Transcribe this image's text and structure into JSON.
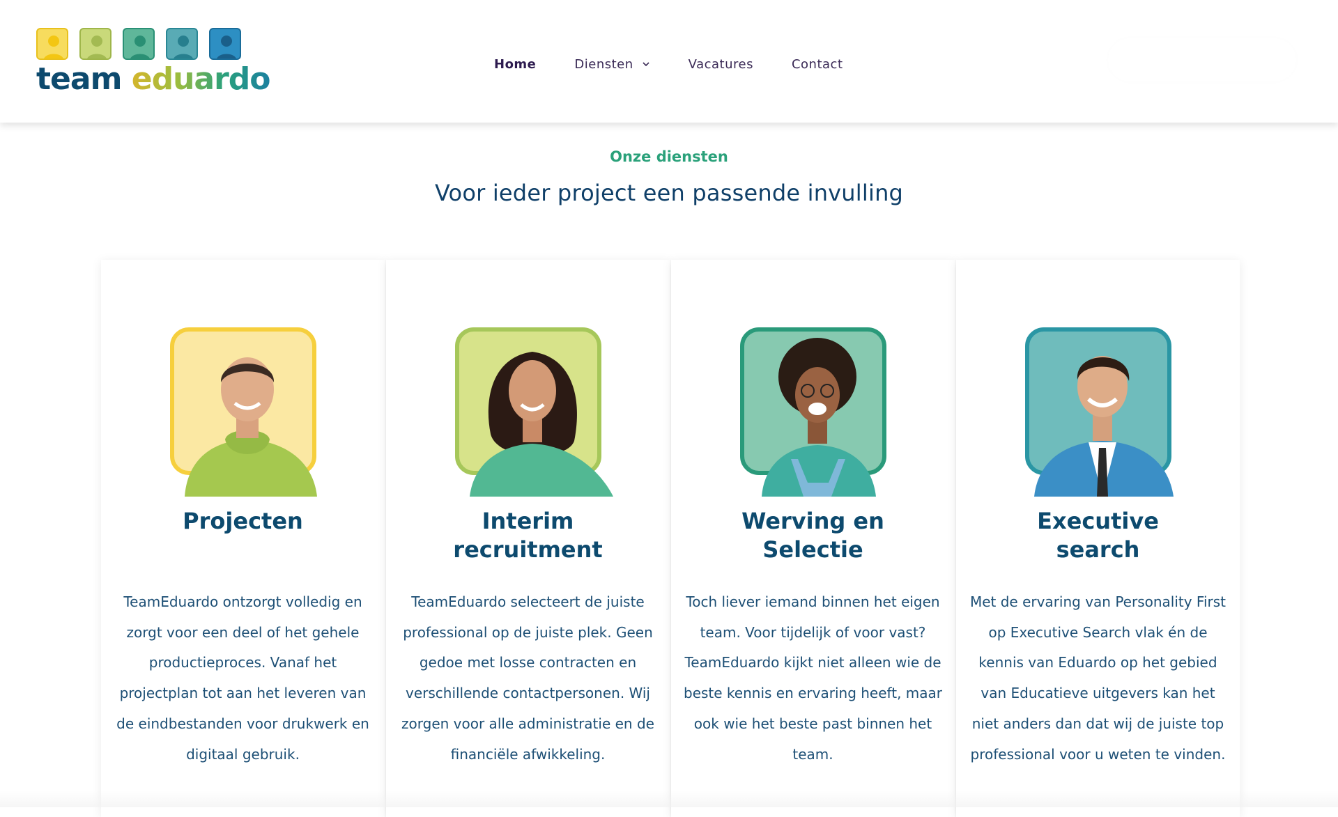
{
  "brand": {
    "name_part1": "team",
    "name_part2": "eduardo",
    "colors": [
      "#f5cd2a",
      "#b5c94b",
      "#2e9e83",
      "#2e9aa9",
      "#1d7fb0"
    ]
  },
  "nav": {
    "items": [
      {
        "label": "Home",
        "active": true
      },
      {
        "label": "Diensten",
        "has_dropdown": true
      },
      {
        "label": "Vacatures"
      },
      {
        "label": "Contact"
      }
    ]
  },
  "section": {
    "eyebrow": "Onze diensten",
    "title": "Voor ieder project een passende invulling"
  },
  "cards": [
    {
      "title": "Projecten",
      "text": "TeamEduardo ontzorgt volledig en zorgt voor een deel of het gehele productieproces. Vanaf het projectplan tot aan het leveren van de eindbestanden voor drukwerk en digitaal gebruik.",
      "frame_color": "#f6cf3d",
      "bg_color": "#fbe8a3",
      "shirt_color": "#a5c84f"
    },
    {
      "title": "Interim recruitment",
      "text": "TeamEduardo selecteert de juiste professional op de juiste plek. Geen gedoe met losse contracten en verschillende contactpersonen. Wij zorgen voor alle administratie en de financiële afwikkeling.",
      "frame_color": "#a6c75a",
      "bg_color": "#d7e38a",
      "shirt_color": "#52b893"
    },
    {
      "title": "Werving en Selectie",
      "text": "Toch liever iemand binnen het eigen team. Voor tijdelijk of voor vast? TeamEduardo kijkt niet alleen wie de beste kennis en ervaring heeft, maar ook wie het beste past binnen het team.",
      "frame_color": "#2a9a7a",
      "bg_color": "#87c9b0",
      "shirt_color": "#7fb8d9"
    },
    {
      "title": "Executive search",
      "text": "Met de ervaring van Personality First op Executive Search vlak én de kennis van Eduardo op het gebied van Educatieve uitgevers kan het niet anders dan dat wij de juiste top professional voor u weten te vinden.",
      "frame_color": "#2a96a4",
      "bg_color": "#6fbcbc",
      "shirt_color": "#3b8fc6"
    }
  ]
}
